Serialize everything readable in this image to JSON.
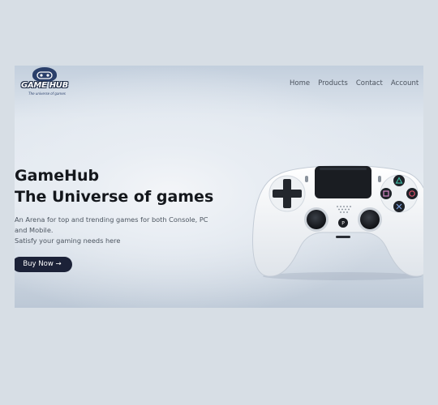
{
  "brand": {
    "logo_title": "GAME HUB",
    "logo_subtitle": "The universe of games"
  },
  "nav": {
    "items": [
      "Home",
      "Products",
      "Contact",
      "Account"
    ]
  },
  "hero": {
    "title_line1": "GameHub",
    "title_line2": "The Universe of games",
    "desc_line1": "An Arena for top and trending games for both Console, PC",
    "desc_line2": "and Mobile.",
    "desc_line3": "Satisfy your gaming needs here",
    "cta_label": "Buy Now →"
  },
  "product_image": {
    "icon": "gamepad-controller-icon"
  },
  "colors": {
    "page_bg": "#d7dee5",
    "button_bg": "#1c2238",
    "heading": "#14171c",
    "nav_text": "#4b535e"
  }
}
